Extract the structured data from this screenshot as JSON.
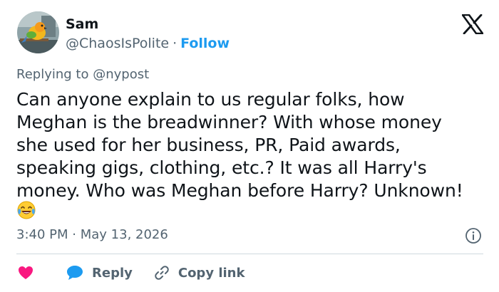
{
  "author": {
    "name": "Sam",
    "handle": "@ChaosIsPolite",
    "separator": "·",
    "follow_label": "Follow"
  },
  "reply_to": {
    "prefix": "Replying to ",
    "handle": "@nypost"
  },
  "tweet": {
    "lines": [
      "Can anyone explain to us regular folks, how",
      "Meghan is the breadwinner? With whose money",
      "she used for her business, PR, Paid awards,",
      "speaking gigs, clothing, etc.? It was all Harry's",
      "money. Who was Meghan before Harry? Unknown!"
    ],
    "emoji": "😂"
  },
  "timestamp": {
    "time": "3:40 PM",
    "separator": "·",
    "date": "May 13, 2026"
  },
  "actions": {
    "reply_label": "Reply",
    "copy_link_label": "Copy link"
  },
  "icons": {
    "brand": "x-logo-icon",
    "info": "info-icon",
    "like": "heart-icon",
    "reply": "speech-bubble-icon",
    "copy": "link-icon"
  },
  "colors": {
    "accent": "#1d9bf0",
    "like": "#f91880",
    "text": "#0f1419",
    "secondary": "#536471",
    "divider": "#cfd9de"
  }
}
